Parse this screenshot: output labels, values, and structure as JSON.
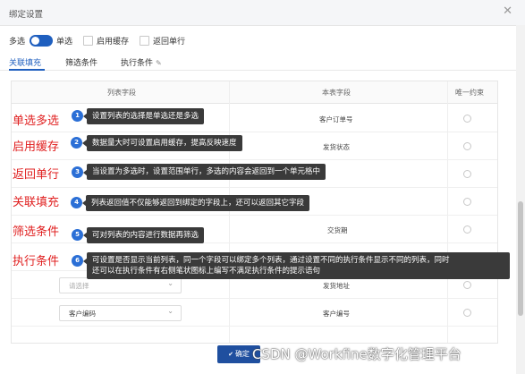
{
  "dialog": {
    "title": "绑定设置",
    "close_glyph": "✕"
  },
  "mode": {
    "multi_label": "多选",
    "single_label": "单选",
    "enable_cache_label": "启用缓存",
    "return_single_row_label": "返回单行"
  },
  "tabs": [
    {
      "label": "关联填充",
      "active": true
    },
    {
      "label": "筛选条件",
      "active": false
    },
    {
      "label": "执行条件",
      "active": false
    }
  ],
  "table": {
    "headers": {
      "list_field": "列表字段",
      "this_field": "本表字段",
      "unique": "唯一约束"
    },
    "rows": [
      {
        "list_field": "",
        "this_field": "客户订单号"
      },
      {
        "list_field": "",
        "this_field": "发货状态"
      },
      {
        "list_field": "",
        "this_field": ""
      },
      {
        "list_field": "",
        "this_field": ""
      },
      {
        "list_field": "",
        "this_field": "交货期"
      },
      {
        "list_field": "",
        "this_field": ""
      },
      {
        "list_field": "请选择",
        "this_field": "发货地址"
      },
      {
        "list_field": "客户编码",
        "this_field": "客户编号"
      },
      {
        "list_field": "",
        "this_field": ""
      }
    ]
  },
  "annotations": [
    {
      "num": "1",
      "label": "单选多选",
      "tip": "设置列表的选择是单选还是多选"
    },
    {
      "num": "2",
      "label": "启用缓存",
      "tip": "数据量大时可设置启用缓存，提高反映速度"
    },
    {
      "num": "3",
      "label": "返回单行",
      "tip": "当设置为多选时，设置范围单行，多选的内容会返回到一个单元格中"
    },
    {
      "num": "4",
      "label": "关联填充",
      "tip": "列表返回值不仅能够返回到绑定的字段上，还可以返回其它字段"
    },
    {
      "num": "5",
      "label": "筛选条件",
      "tip": "可对列表的内容进行数据再筛选"
    },
    {
      "num": "6",
      "label": "执行条件",
      "tip_line1": "可设置是否显示当前列表，同一个字段可以绑定多个列表，通过设置不同的执行条件显示不同的列表，同时",
      "tip_line2": "还可以在执行条件有右侧笔状图标上编写不满足执行条件的提示语句"
    }
  ],
  "footer": {
    "confirm_label": "确定"
  },
  "watermark": "CSDN @Workfine数字化管理平台",
  "colors": {
    "accent": "#1f5fbf",
    "annotation_red": "#e02020",
    "badge_blue": "#2b6fd6",
    "tooltip_bg": "#3a3a3a"
  }
}
